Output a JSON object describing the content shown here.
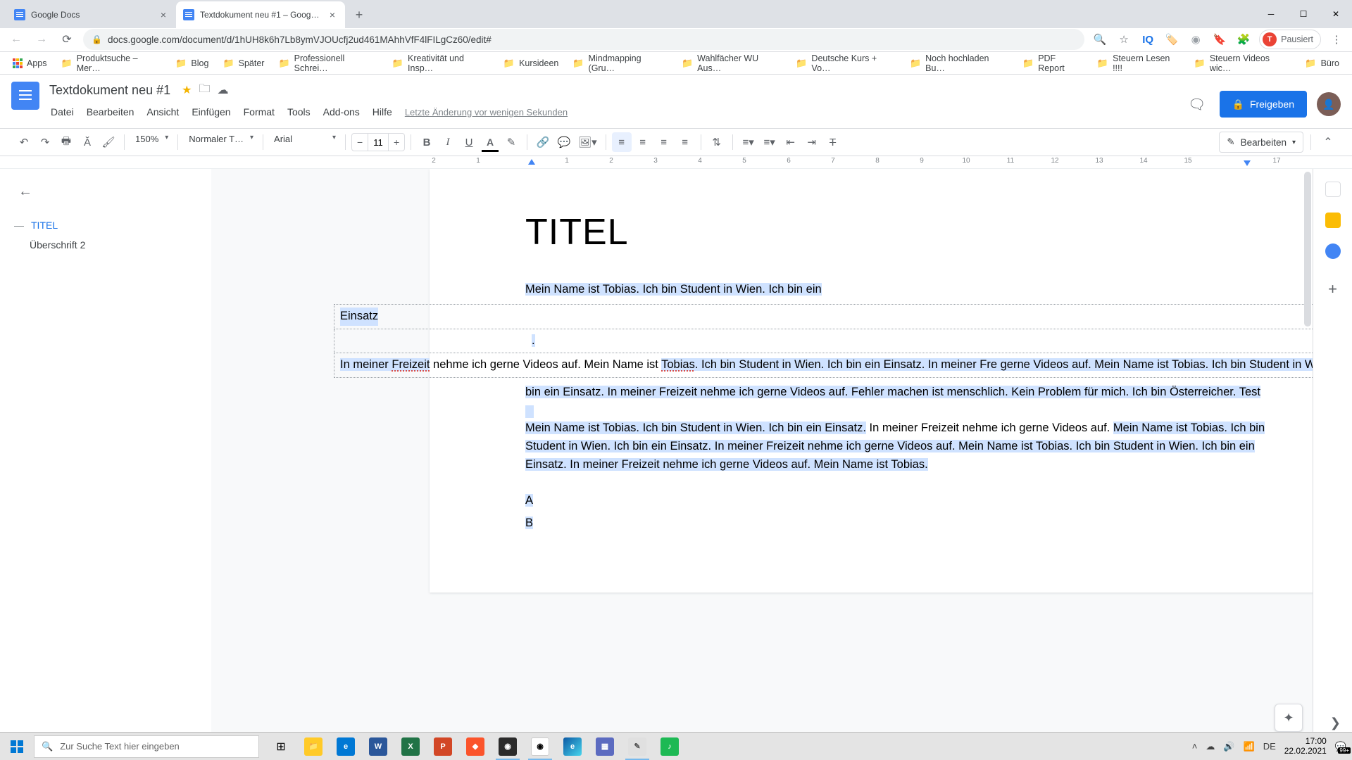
{
  "browser": {
    "tabs": [
      {
        "title": "Google Docs",
        "active": false
      },
      {
        "title": "Textdokument neu #1 – Google Docs",
        "active": true
      }
    ],
    "url": "docs.google.com/document/d/1hUH8k6h7Lb8ymVJOUcfj2ud461MAhhVfF4lFILgCz60/edit#",
    "profile_label": "Pausiert",
    "profile_initial": "T",
    "bookmarks": {
      "apps": "Apps",
      "items": [
        "Produktsuche – Mer…",
        "Blog",
        "Später",
        "Professionell Schrei…",
        "Kreativität und Insp…",
        "Kursideen",
        "Mindmapping  (Gru…",
        "Wahlfächer WU Aus…",
        "Deutsche Kurs + Vo…",
        "Noch hochladen Bu…",
        "PDF Report",
        "Steuern Lesen !!!!",
        "Steuern Videos wic…",
        "Büro"
      ]
    }
  },
  "docs": {
    "title": "Textdokument neu #1",
    "menus": [
      "Datei",
      "Bearbeiten",
      "Ansicht",
      "Einfügen",
      "Format",
      "Tools",
      "Add-ons",
      "Hilfe"
    ],
    "last_edit": "Letzte Änderung vor wenigen Sekunden",
    "share": "Freigeben",
    "mode": "Bearbeiten",
    "zoom": "150%",
    "style_select": "Normaler T…",
    "font": "Arial",
    "font_size": "11"
  },
  "ruler": [
    "2",
    "1",
    "",
    "1",
    "2",
    "3",
    "4",
    "5",
    "6",
    "7",
    "8",
    "9",
    "10",
    "11",
    "12",
    "13",
    "14",
    "15",
    "",
    "17"
  ],
  "outline": {
    "h1": "TITEL",
    "h2": "Überschrift 2"
  },
  "document": {
    "title": "TITEL",
    "p1": "Mein Name ist Tobias. Ich bin Student in Wien. Ich bin ein",
    "table_r1": "Einsatz",
    "table_r2": ".",
    "table_r3a": "In meiner ",
    "table_r3_link1": "Freizeit",
    "table_r3b": " nehme ich gerne Videos auf. Mein Name ist ",
    "table_r3_link2": "Tobias",
    "table_r3c": ". Ich bin Student in Wien. Ich bin ein Einsatz. In meiner Fre gerne Videos auf. Mein Name ist Tobias. Ich bin Student in Wien. Ich",
    "p2": " bin ein Einsatz. In meiner Freizeit nehme ich gerne Videos auf. Fehler machen ist menschlich. Kein Problem für mich. Ich bin Österreicher. Test",
    "p3a": "Mein Name ist Tobias. Ich bin Student in Wien. Ich bin ein Einsatz.",
    "p3b": " In meiner Freizeit nehme ich gerne Videos auf. ",
    "p3c": "Mein Name ist Tobias. Ich bin Student in Wien. Ich bin ein Einsatz. In meiner Freizeit nehme ich gerne Videos auf. Mein Name ist Tobias. Ich bin Student in Wien. Ich bin ein Einsatz. In meiner Freizeit nehme ich gerne Videos auf. Mein Name ist Tobias.",
    "listA": "A",
    "listB": "B"
  },
  "taskbar": {
    "search_placeholder": "Zur Suche Text hier eingeben",
    "lang": "DE",
    "time": "17:00",
    "date": "22.02.2021",
    "notif": "99+"
  },
  "colors": {
    "google_blue": "#4285f4",
    "share_blue": "#1a73e8",
    "sel": "#cfe2ff"
  }
}
